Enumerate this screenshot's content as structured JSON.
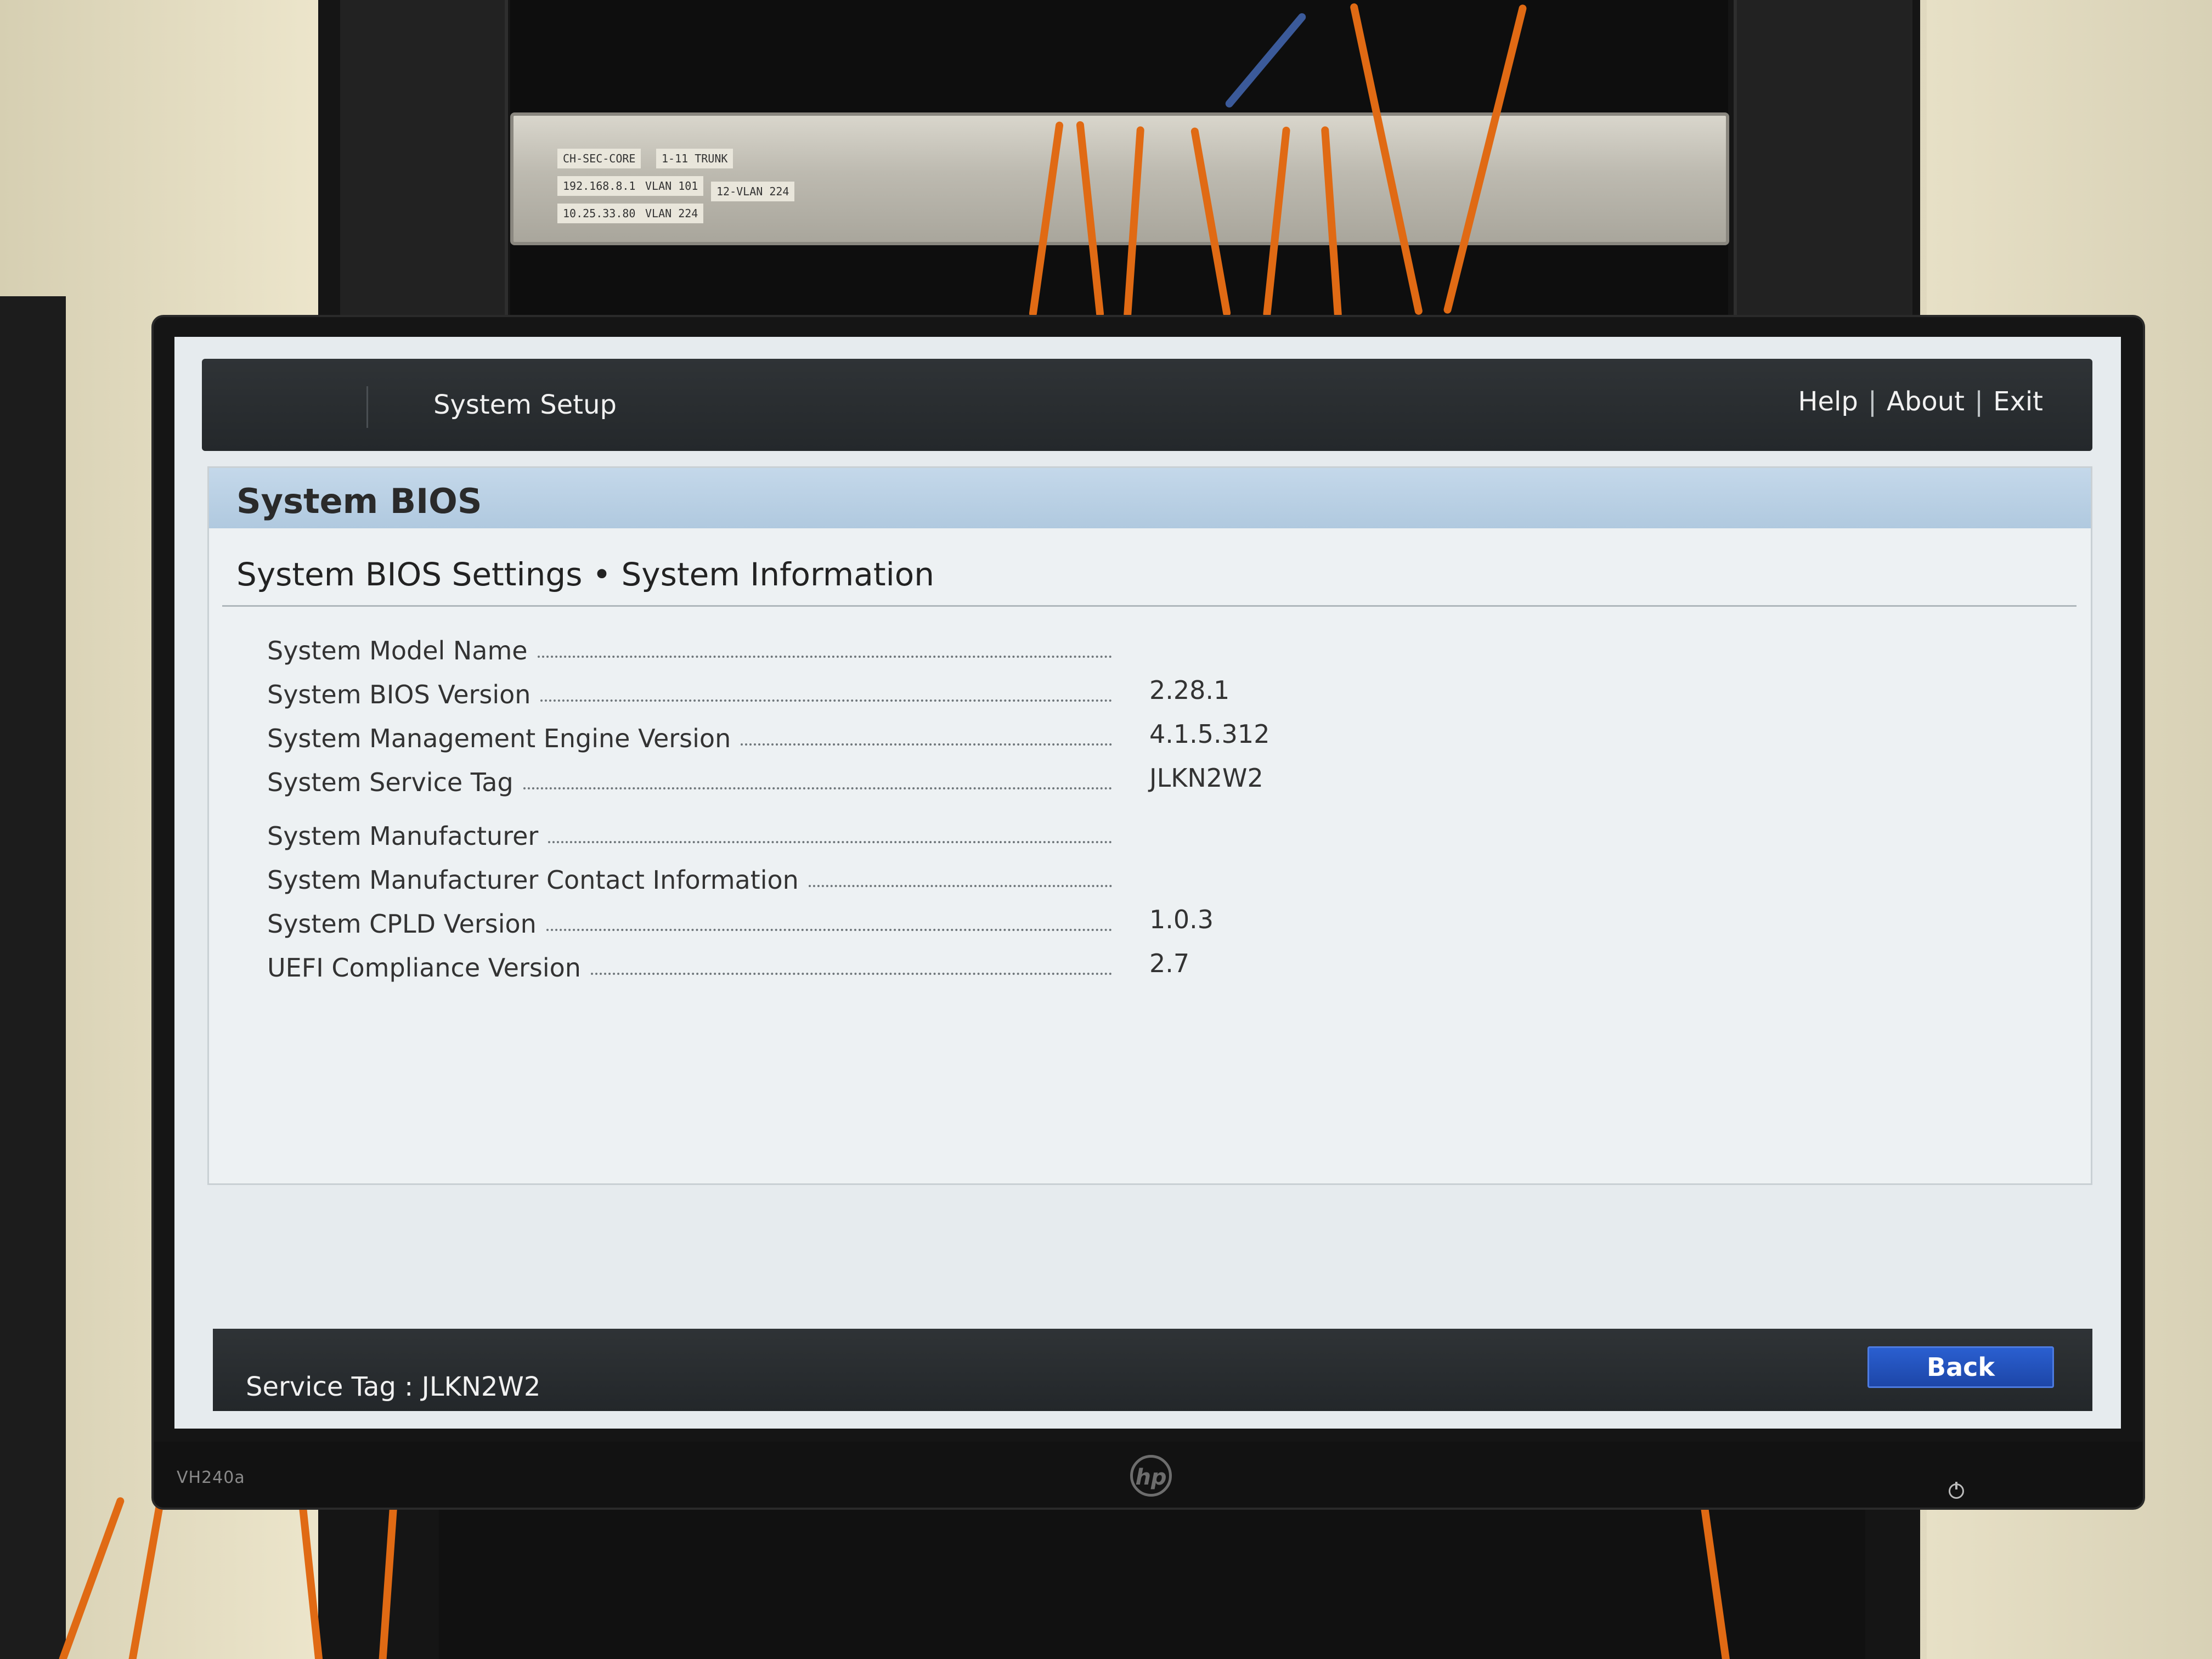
{
  "device": {
    "switch_labels": [
      "CH-SEC-CORE",
      "1-11 TRUNK",
      "192.168.8.1",
      "VLAN 101",
      "12-VLAN 224",
      "10.25.33.80",
      "VLAN 224"
    ],
    "monitor_model": "VH240a",
    "monitor_brand": "hp"
  },
  "header": {
    "title": "System Setup",
    "links": [
      "Help",
      "About",
      "Exit"
    ],
    "separator": "|"
  },
  "page": {
    "title": "System BIOS",
    "breadcrumb": "System BIOS Settings • System Information"
  },
  "info_rows": [
    {
      "label": "System Model Name",
      "value": ""
    },
    {
      "label": "System BIOS Version",
      "value": "2.28.1"
    },
    {
      "label": "System Management Engine Version",
      "value": "4.1.5.312"
    },
    {
      "label": "System Service Tag",
      "value": "JLKN2W2"
    },
    {
      "label": "System Manufacturer",
      "value": ""
    },
    {
      "label": "System Manufacturer Contact Information",
      "value": ""
    },
    {
      "label": "System CPLD Version",
      "value": "1.0.3"
    },
    {
      "label": "UEFI Compliance Version",
      "value": "2.7"
    }
  ],
  "footer": {
    "service_tag": "Service Tag : JLKN2W2",
    "back_label": "Back"
  },
  "colors": {
    "bar_dark": "#2a2e31",
    "header_band": "#b7cfe4",
    "back_button": "#2456c4",
    "screen_bg": "#e6ebee"
  }
}
